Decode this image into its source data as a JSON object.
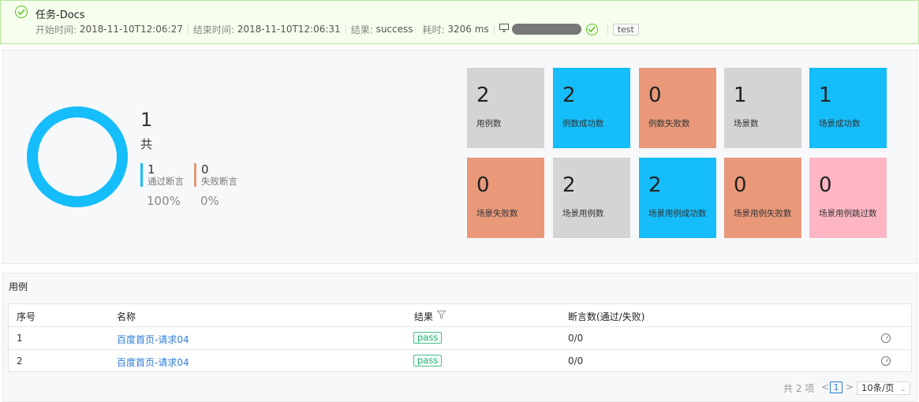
{
  "header": {
    "title": "任务-Docs",
    "start_label": "开始时间:",
    "start_value": "2018-11-10T12:06:27",
    "end_label": "结束时间:",
    "end_value": "2018-11-10T12:06:31",
    "result_label": "结果:",
    "result_value": "success",
    "duration_label": "耗时:",
    "duration_value": "3206 ms",
    "env_tag": "test"
  },
  "summary": {
    "total": "1",
    "total_label": "共",
    "pass_count": "1",
    "pass_label": "通过断言",
    "pass_pct": "100%",
    "fail_count": "0",
    "fail_label": "失败断言",
    "fail_pct": "0%",
    "pass_fraction": 1.0,
    "ring_color": "#15bdfb",
    "pass_color": "#15bdfb",
    "fail_color": "#e9997a"
  },
  "cards": [
    {
      "value": "2",
      "label": "用例数"
    },
    {
      "value": "2",
      "label": "例数成功数"
    },
    {
      "value": "0",
      "label": "例数失败数"
    },
    {
      "value": "1",
      "label": "场景数"
    },
    {
      "value": "1",
      "label": "场景成功数"
    },
    {
      "value": "0",
      "label": "场景失败数"
    },
    {
      "value": "2",
      "label": "场景用例数"
    },
    {
      "value": "2",
      "label": "场景用例成功数"
    },
    {
      "value": "0",
      "label": "场景用例失败数"
    },
    {
      "value": "0",
      "label": "场景用例跳过数"
    }
  ],
  "cases": {
    "title": "用例",
    "columns": {
      "index": "序号",
      "name": "名称",
      "result": "结果",
      "assertions": "断言数(通过/失败)"
    },
    "rows": [
      {
        "index": "1",
        "name": "百度首页-请求04",
        "result": "pass",
        "assertions": "0/0"
      },
      {
        "index": "2",
        "name": "百度首页-请求04",
        "result": "pass",
        "assertions": "0/0"
      }
    ],
    "pagination": {
      "total_text": "共 2 项",
      "prev": "<",
      "page": "1",
      "next": ">",
      "page_size": "10条/页"
    }
  }
}
